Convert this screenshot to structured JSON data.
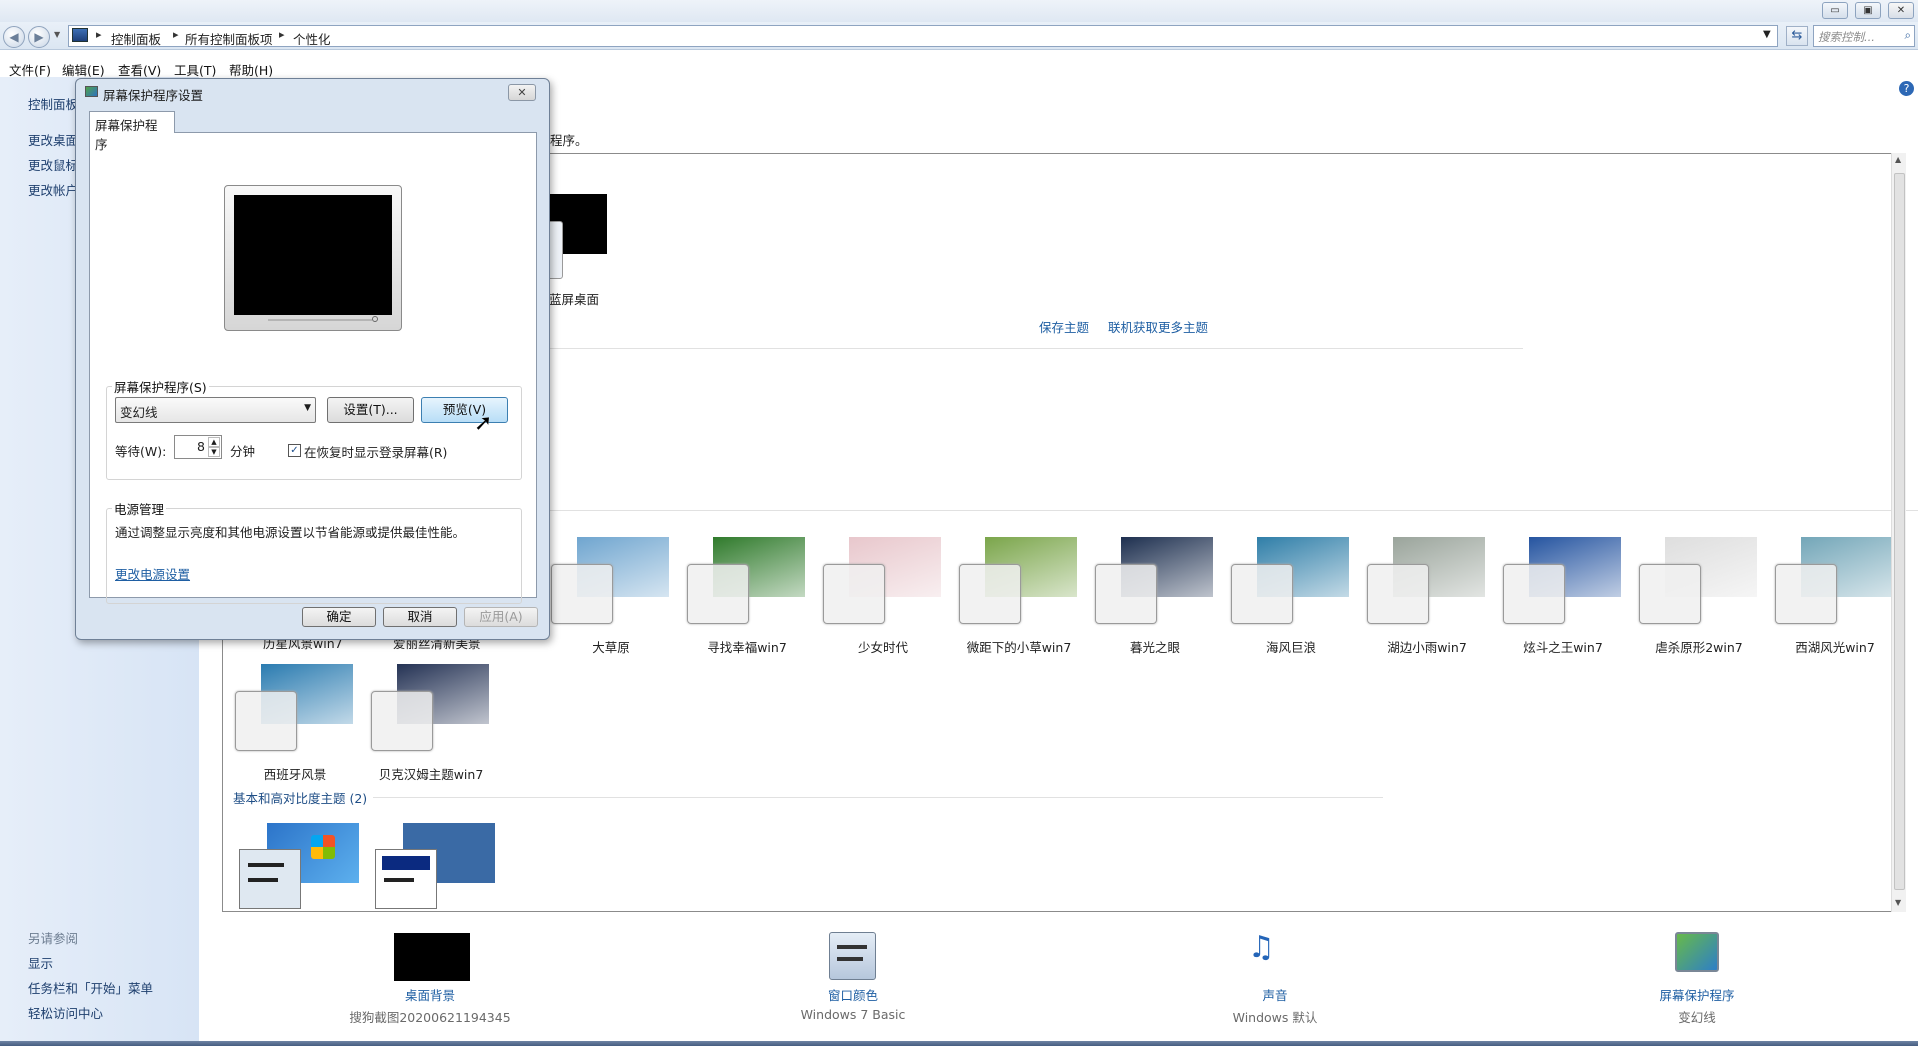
{
  "window": {
    "controls": {
      "minimize": "▭",
      "restore": "▣",
      "close": "✕"
    }
  },
  "address": {
    "crumbs": [
      "控制面板",
      "所有控制面板项",
      "个性化"
    ],
    "search_placeholder": "搜索控制..."
  },
  "menu": [
    "文件(F)",
    "编辑(E)",
    "查看(V)",
    "工具(T)",
    "帮助(H)"
  ],
  "left_pane": {
    "links": [
      "控制面板",
      "更改桌面",
      "更改鼠标",
      "更改帐户"
    ],
    "see_also_title": "另请参阅",
    "see_also": [
      "显示",
      "任务栏和「开始」菜单",
      "轻松访问中心"
    ]
  },
  "main": {
    "intro_tail": "程序。",
    "my_theme_label": "蓝屏桌面",
    "save_theme": "保存主题",
    "get_more": "联机获取更多主题",
    "installed_themes": [
      {
        "label": "大草原",
        "color": "#6fa5cf"
      },
      {
        "label": "寻找幸福win7",
        "color": "#2f7a2b"
      },
      {
        "label": "少女时代",
        "color": "#e8c7cc"
      },
      {
        "label": "微距下的小草win7",
        "color": "#7aa54a"
      },
      {
        "label": "暮光之眼",
        "color": "#1d2f4f"
      },
      {
        "label": "海风巨浪",
        "color": "#2f7ea8"
      },
      {
        "label": "湖边小雨win7",
        "color": "#9aa49b"
      },
      {
        "label": "炫斗之王win7",
        "color": "#2554a0"
      },
      {
        "label": "虐杀原形2win7",
        "color": "#dedede"
      },
      {
        "label": "西湖风光win7",
        "color": "#73a6b8"
      },
      {
        "label": "西班牙风景",
        "color": "#2a7bb0"
      },
      {
        "label": "贝克汉姆主题win7",
        "color": "#243254"
      }
    ],
    "partial_labels": [
      "历星风景win7",
      "爱丽丝清新美景"
    ],
    "basic_section": "基本和高对比度主题 (2)"
  },
  "bottom": [
    {
      "label": "桌面背景",
      "sub": "搜狗截图20200621194345"
    },
    {
      "label": "窗口颜色",
      "sub": "Windows 7 Basic"
    },
    {
      "label": "声音",
      "sub": "Windows 默认"
    },
    {
      "label": "屏幕保护程序",
      "sub": "变幻线"
    }
  ],
  "dialog": {
    "title": "屏幕保护程序设置",
    "tab": "屏幕保护程序",
    "saver_group": "屏幕保护程序(S)",
    "saver_value": "变幻线",
    "settings_btn": "设置(T)...",
    "preview_btn": "预览(V)",
    "wait_label": "等待(W):",
    "wait_value": "8",
    "minutes": "分钟",
    "resume_label": "在恢复时显示登录屏幕(R)",
    "resume_checked": true,
    "power_group": "电源管理",
    "power_text": "通过调整显示亮度和其他电源设置以节省能源或提供最佳性能。",
    "power_link": "更改电源设置",
    "ok": "确定",
    "cancel": "取消",
    "apply": "应用(A)"
  }
}
